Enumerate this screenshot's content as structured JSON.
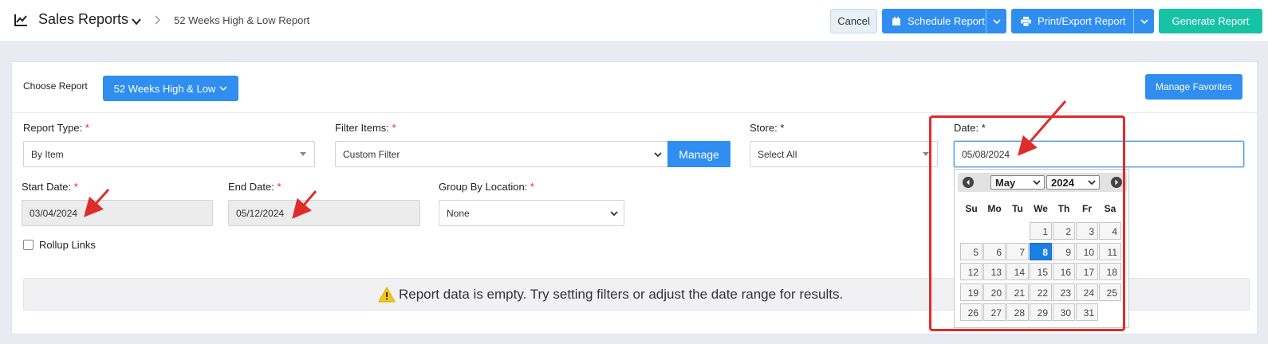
{
  "header": {
    "title": "Sales Reports",
    "breadcrumb": "52 Weeks High & Low Report",
    "cancel_label": "Cancel",
    "schedule_label": "Schedule Report",
    "print_label": "Print/Export Report",
    "generate_label": "Generate Report"
  },
  "chooser": {
    "label": "Choose Report",
    "selected_report": "52 Weeks High & Low",
    "favorites_label": "Manage Favorites"
  },
  "form": {
    "report_type": {
      "label": "Report Type:",
      "required": "*",
      "value": "By Item"
    },
    "filter_items": {
      "label": "Filter Items:",
      "required": "*",
      "value": "Custom Filter",
      "manage_label": "Manage"
    },
    "store": {
      "label": "Store:",
      "required": "*",
      "value": "Select All"
    },
    "date": {
      "label": "Date:",
      "required": "*",
      "value": "05/08/2024"
    },
    "start_date": {
      "label": "Start Date:",
      "required": "*",
      "value": "03/04/2024"
    },
    "end_date": {
      "label": "End Date:",
      "required": "*",
      "value": "05/12/2024"
    },
    "group_by_location": {
      "label": "Group By Location:",
      "required": "*",
      "value": "None"
    },
    "rollup_links": {
      "label": "Rollup Links",
      "checked": false
    }
  },
  "alert": {
    "message": "Report data is empty. Try setting filters or adjust the date range for results."
  },
  "datepicker": {
    "month": "May",
    "year": "2024",
    "weekdays": [
      "Su",
      "Mo",
      "Tu",
      "We",
      "Th",
      "Fr",
      "Sa"
    ],
    "first_weekday_index": 3,
    "days_in_month": 31,
    "selected_day": 8
  },
  "colors": {
    "primary": "#2f8ef0",
    "generate": "#17c3a5",
    "required": "#e03030",
    "annotation": "#e02b2b",
    "selected_day": "#1a7fe3"
  }
}
